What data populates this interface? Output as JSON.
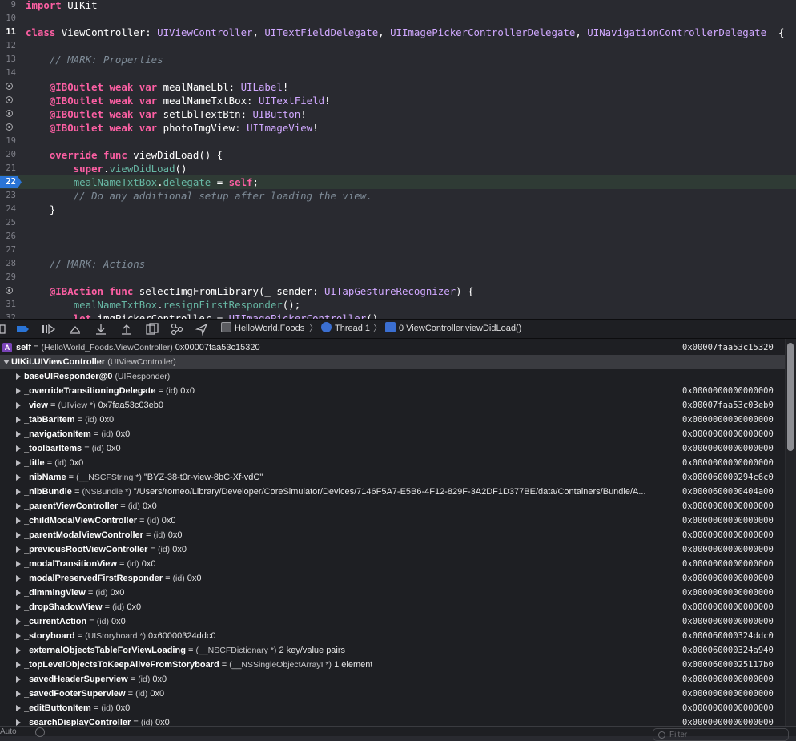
{
  "editor": {
    "lines": [
      {
        "num": "9",
        "html": "<span class=\"kw\">import</span> UIKit"
      },
      {
        "num": "10",
        "html": ""
      },
      {
        "num": "11",
        "html": "<span class=\"kw\">class</span> ViewController: <span class=\"ty2\">UIViewController</span>, <span class=\"ty2\">UITextFieldDelegate</span>, <span class=\"ty2\">UIImagePickerControllerDelegate</span>, <span class=\"ty2\">UINavigationControllerDelegate</span>  {"
      },
      {
        "num": "12",
        "html": ""
      },
      {
        "num": "13",
        "html": "    <span class=\"cm\">// MARK: Properties</span>"
      },
      {
        "num": "14",
        "html": ""
      },
      {
        "num": "15",
        "html": "    <span class=\"kw\">@IBOutlet</span> <span class=\"kw\">weak</span> <span class=\"kw\">var</span> mealNameLbl: <span class=\"ty2\">UILabel</span>!"
      },
      {
        "num": "16",
        "html": "    <span class=\"kw\">@IBOutlet</span> <span class=\"kw\">weak</span> <span class=\"kw\">var</span> mealNameTxtBox: <span class=\"ty2\">UITextField</span>!"
      },
      {
        "num": "17",
        "html": "    <span class=\"kw\">@IBOutlet</span> <span class=\"kw\">weak</span> <span class=\"kw\">var</span> setLblTextBtn: <span class=\"ty2\">UIButton</span>!"
      },
      {
        "num": "18",
        "html": "    <span class=\"kw\">@IBOutlet</span> <span class=\"kw\">weak</span> <span class=\"kw\">var</span> photoImgView: <span class=\"ty2\">UIImageView</span>!"
      },
      {
        "num": "19",
        "html": ""
      },
      {
        "num": "20",
        "html": "    <span class=\"kw\">override</span> <span class=\"kw\">func</span> viewDidLoad() {"
      },
      {
        "num": "21",
        "html": "        <span class=\"kw\">super</span>.<span class=\"mb\">viewDidLoad</span>()"
      },
      {
        "num": "22",
        "html": "        <span class=\"mb\">mealNameTxtBox</span>.<span class=\"mb\">delegate</span> = <span class=\"kw\">self</span>;"
      },
      {
        "num": "23",
        "html": "        <span class=\"cm\">// Do any additional setup after loading the view.</span>"
      },
      {
        "num": "24",
        "html": "    }"
      },
      {
        "num": "25",
        "html": ""
      },
      {
        "num": "26",
        "html": ""
      },
      {
        "num": "27",
        "html": ""
      },
      {
        "num": "28",
        "html": "    <span class=\"cm\">// MARK: Actions</span>"
      },
      {
        "num": "29",
        "html": ""
      },
      {
        "num": "30",
        "html": "    <span class=\"kw\">@IBAction</span> <span class=\"kw\">func</span> selectImgFromLibrary(_ sender: <span class=\"ty2\">UITapGestureRecognizer</span>) {"
      },
      {
        "num": "31",
        "html": "        <span class=\"mb\">mealNameTxtBox</span>.<span class=\"mb\">resignFirstResponder</span>();"
      },
      {
        "num": "32",
        "html": "        <span class=\"kw\">let</span> imgPickerController = <span class=\"ty2\">UIImagePickerController</span>()"
      }
    ]
  },
  "debugbar": {
    "target": "HelloWorld.Foods",
    "thread": "Thread 1",
    "frame": "0 ViewController.viewDidLoad()"
  },
  "vars": {
    "rows": [
      {
        "indent": 0,
        "badge": "A",
        "name": "self",
        "eq": " = ",
        "type": "(HelloWorld_Foods.ViewController)",
        "value": " 0x00007faa53c15320",
        "addr": "0x00007faa53c15320",
        "expander": "none",
        "sel": false
      },
      {
        "indent": 0,
        "name": "UIKit.UIViewController",
        "eq": " ",
        "type": "(UIViewController)",
        "value": "",
        "addr": "",
        "expander": "down",
        "sel": true
      },
      {
        "indent": 1,
        "name": "baseUIResponder@0",
        "eq": " ",
        "type": "(UIResponder)",
        "value": "",
        "addr": "",
        "expander": "right",
        "sel": false
      },
      {
        "indent": 1,
        "name": "_overrideTransitioningDelegate",
        "eq": " = ",
        "type": "(id)",
        "value": " 0x0",
        "addr": "0x0000000000000000",
        "expander": "right",
        "sel": false
      },
      {
        "indent": 1,
        "name": "_view",
        "eq": " = ",
        "type": "(UIView *)",
        "value": " 0x7faa53c03eb0",
        "addr": "0x00007faa53c03eb0",
        "expander": "right",
        "sel": false
      },
      {
        "indent": 1,
        "name": "_tabBarItem",
        "eq": " = ",
        "type": "(id)",
        "value": " 0x0",
        "addr": "0x0000000000000000",
        "expander": "right",
        "sel": false
      },
      {
        "indent": 1,
        "name": "_navigationItem",
        "eq": " = ",
        "type": "(id)",
        "value": " 0x0",
        "addr": "0x0000000000000000",
        "expander": "right",
        "sel": false
      },
      {
        "indent": 1,
        "name": "_toolbarItems",
        "eq": " = ",
        "type": "(id)",
        "value": " 0x0",
        "addr": "0x0000000000000000",
        "expander": "right",
        "sel": false
      },
      {
        "indent": 1,
        "name": "_title",
        "eq": " = ",
        "type": "(id)",
        "value": " 0x0",
        "addr": "0x0000000000000000",
        "expander": "right",
        "sel": false
      },
      {
        "indent": 1,
        "name": "_nibName",
        "eq": " = ",
        "type": "(__NSCFString *)",
        "value": " \"BYZ-38-t0r-view-8bC-Xf-vdC\"",
        "addr": "0x000060000294c6c0",
        "expander": "right",
        "sel": false
      },
      {
        "indent": 1,
        "name": "_nibBundle",
        "eq": " = ",
        "type": "(NSBundle *)",
        "value": " \"/Users/romeo/Library/Developer/CoreSimulator/Devices/7146F5A7-E5B6-4F12-829F-3A2DF1D377BE/data/Containers/Bundle/A...",
        "addr": "0x0000600000404a00",
        "expander": "right",
        "sel": false
      },
      {
        "indent": 1,
        "name": "_parentViewController",
        "eq": " = ",
        "type": "(id)",
        "value": " 0x0",
        "addr": "0x0000000000000000",
        "expander": "right",
        "sel": false
      },
      {
        "indent": 1,
        "name": "_childModalViewController",
        "eq": " = ",
        "type": "(id)",
        "value": " 0x0",
        "addr": "0x0000000000000000",
        "expander": "right",
        "sel": false
      },
      {
        "indent": 1,
        "name": "_parentModalViewController",
        "eq": " = ",
        "type": "(id)",
        "value": " 0x0",
        "addr": "0x0000000000000000",
        "expander": "right",
        "sel": false
      },
      {
        "indent": 1,
        "name": "_previousRootViewController",
        "eq": " = ",
        "type": "(id)",
        "value": " 0x0",
        "addr": "0x0000000000000000",
        "expander": "right",
        "sel": false
      },
      {
        "indent": 1,
        "name": "_modalTransitionView",
        "eq": " = ",
        "type": "(id)",
        "value": " 0x0",
        "addr": "0x0000000000000000",
        "expander": "right",
        "sel": false
      },
      {
        "indent": 1,
        "name": "_modalPreservedFirstResponder",
        "eq": " = ",
        "type": "(id)",
        "value": " 0x0",
        "addr": "0x0000000000000000",
        "expander": "right",
        "sel": false
      },
      {
        "indent": 1,
        "name": "_dimmingView",
        "eq": " = ",
        "type": "(id)",
        "value": " 0x0",
        "addr": "0x0000000000000000",
        "expander": "right",
        "sel": false
      },
      {
        "indent": 1,
        "name": "_dropShadowView",
        "eq": " = ",
        "type": "(id)",
        "value": " 0x0",
        "addr": "0x0000000000000000",
        "expander": "right",
        "sel": false
      },
      {
        "indent": 1,
        "name": "_currentAction",
        "eq": " = ",
        "type": "(id)",
        "value": " 0x0",
        "addr": "0x0000000000000000",
        "expander": "right",
        "sel": false
      },
      {
        "indent": 1,
        "name": "_storyboard",
        "eq": " = ",
        "type": "(UIStoryboard *)",
        "value": " 0x60000324ddc0",
        "addr": "0x000060000324ddc0",
        "expander": "right",
        "sel": false
      },
      {
        "indent": 1,
        "name": "_externalObjectsTableForViewLoading",
        "eq": " = ",
        "type": "(__NSCFDictionary *)",
        "value": " 2 key/value pairs",
        "addr": "0x000060000324a940",
        "expander": "right",
        "sel": false
      },
      {
        "indent": 1,
        "name": "_topLevelObjectsToKeepAliveFromStoryboard",
        "eq": " = ",
        "type": "(__NSSingleObjectArrayI *)",
        "value": " 1 element",
        "addr": "0x00006000025117b0",
        "expander": "right",
        "sel": false
      },
      {
        "indent": 1,
        "name": "_savedHeaderSuperview",
        "eq": " = ",
        "type": "(id)",
        "value": " 0x0",
        "addr": "0x0000000000000000",
        "expander": "right",
        "sel": false
      },
      {
        "indent": 1,
        "name": "_savedFooterSuperview",
        "eq": " = ",
        "type": "(id)",
        "value": " 0x0",
        "addr": "0x0000000000000000",
        "expander": "right",
        "sel": false
      },
      {
        "indent": 1,
        "name": "_editButtonItem",
        "eq": " = ",
        "type": "(id)",
        "value": " 0x0",
        "addr": "0x0000000000000000",
        "expander": "right",
        "sel": false
      },
      {
        "indent": 1,
        "name": "_searchDisplayController",
        "eq": " = ",
        "type": "(id)",
        "value": " 0x0",
        "addr": "0x0000000000000000",
        "expander": "right",
        "sel": false
      }
    ]
  },
  "bottom": {
    "left_label": "Auto",
    "filter_placeholder": "Filter"
  },
  "colors": {
    "editor_bg": "#292a30",
    "keyword": "#fc5fa3",
    "type": "#d0a8ff",
    "comment": "#7f8c98",
    "member": "#67b7a4",
    "breakpoint": "#2a74d6",
    "current_line": "#2f3b35"
  }
}
